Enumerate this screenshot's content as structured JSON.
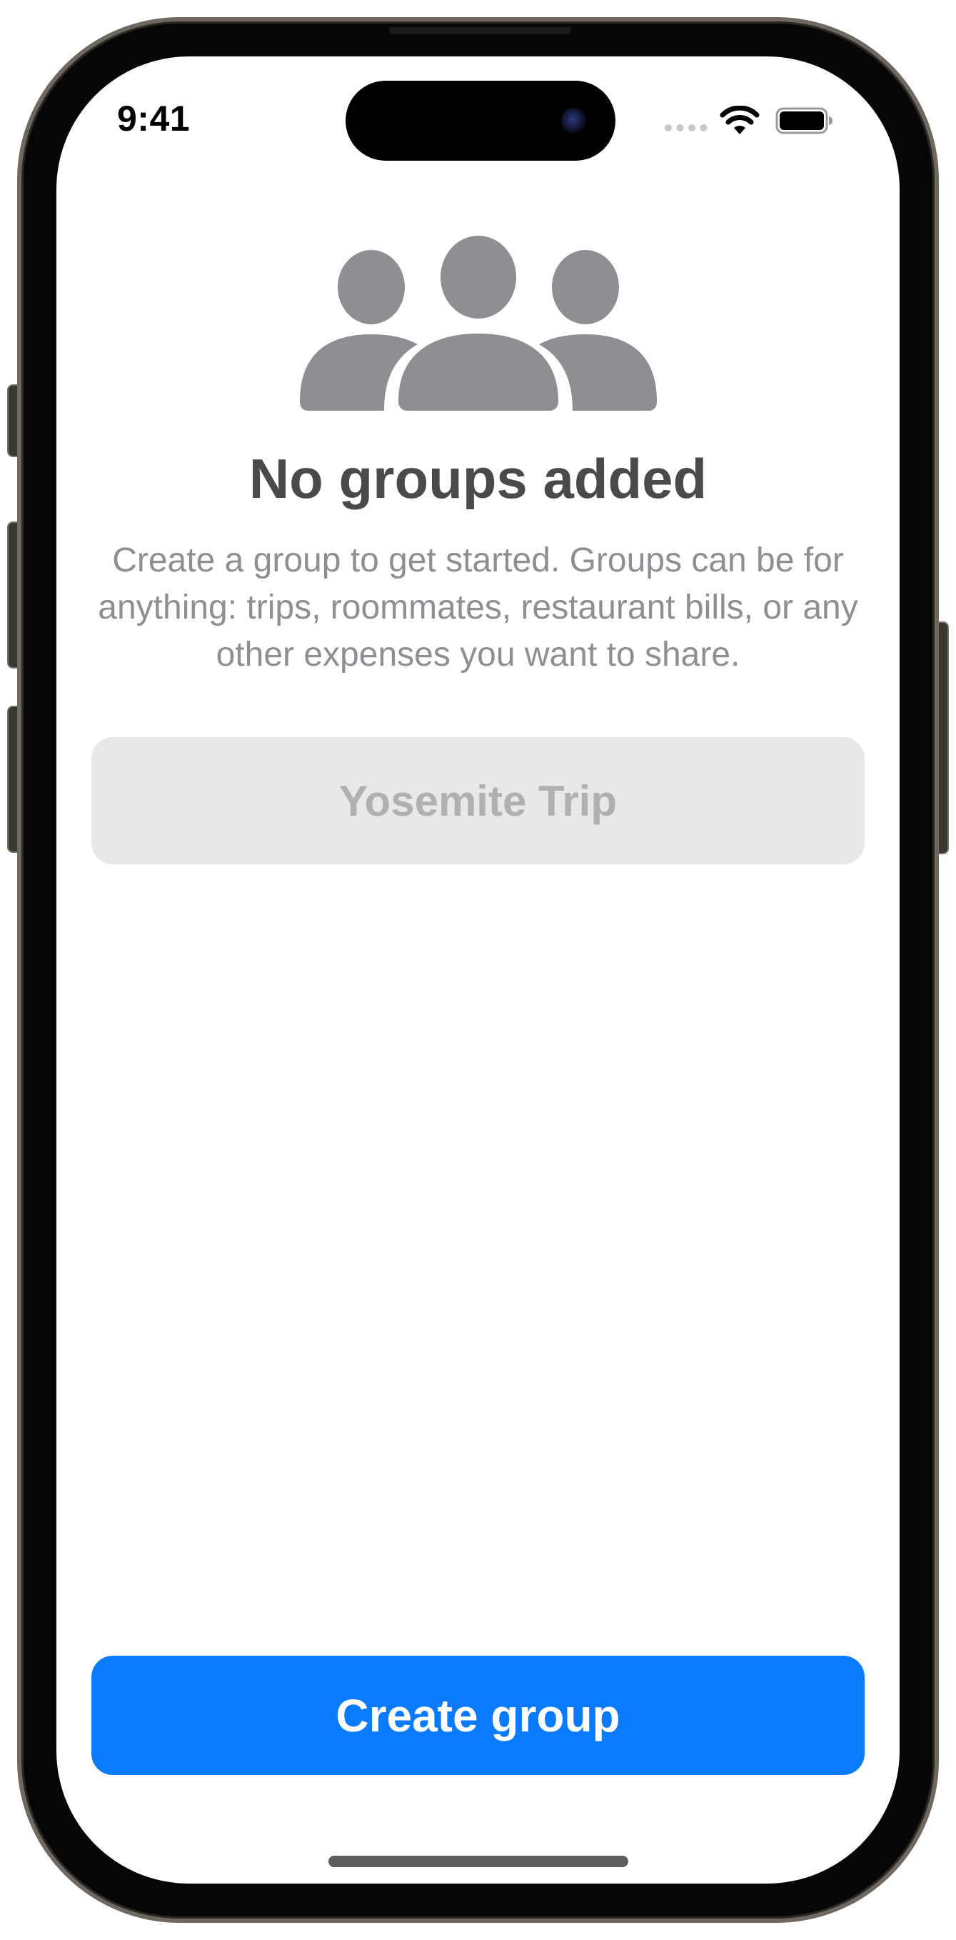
{
  "status_bar": {
    "time": "9:41",
    "signal_icon": "cellular-signal-icon",
    "wifi_icon": "wifi-icon",
    "battery_icon": "battery-icon"
  },
  "empty_state": {
    "icon": "person-3-fill-icon",
    "title": "No groups added",
    "description": "Create a group to get started. Groups can be for anything: trips, roommates, restaurant bills, or any other expenses you want to share.",
    "suggestion_label": "Yosemite Trip"
  },
  "actions": {
    "create_group_label": "Create group"
  },
  "colors": {
    "accent": "#0a7aff",
    "icon_gray": "#8e8e93",
    "title_gray": "#4a4a4c",
    "chip_background": "#e8e8e9"
  }
}
